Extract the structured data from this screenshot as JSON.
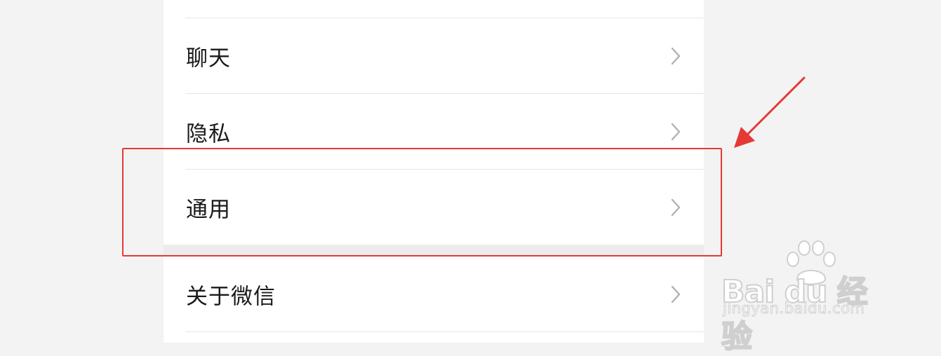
{
  "settings_list": {
    "items": [
      {
        "label": "聊天",
        "icon": "chevron-right-icon"
      },
      {
        "label": "隐私",
        "icon": "chevron-right-icon"
      },
      {
        "label": "通用",
        "icon": "chevron-right-icon",
        "highlighted": true
      },
      {
        "label": "关于微信",
        "icon": "chevron-right-icon"
      }
    ]
  },
  "annotation": {
    "highlight_color": "#e53935",
    "arrow_color": "#e53935"
  },
  "watermark": {
    "brand": "Bai du 经验",
    "url": "jingyan.baidu.com"
  },
  "colors": {
    "background": "#f3f3f3",
    "panel": "#ffffff",
    "text": "#1a1a1a",
    "chevron": "#b2b2b2",
    "divider": "#e5e5e5"
  }
}
